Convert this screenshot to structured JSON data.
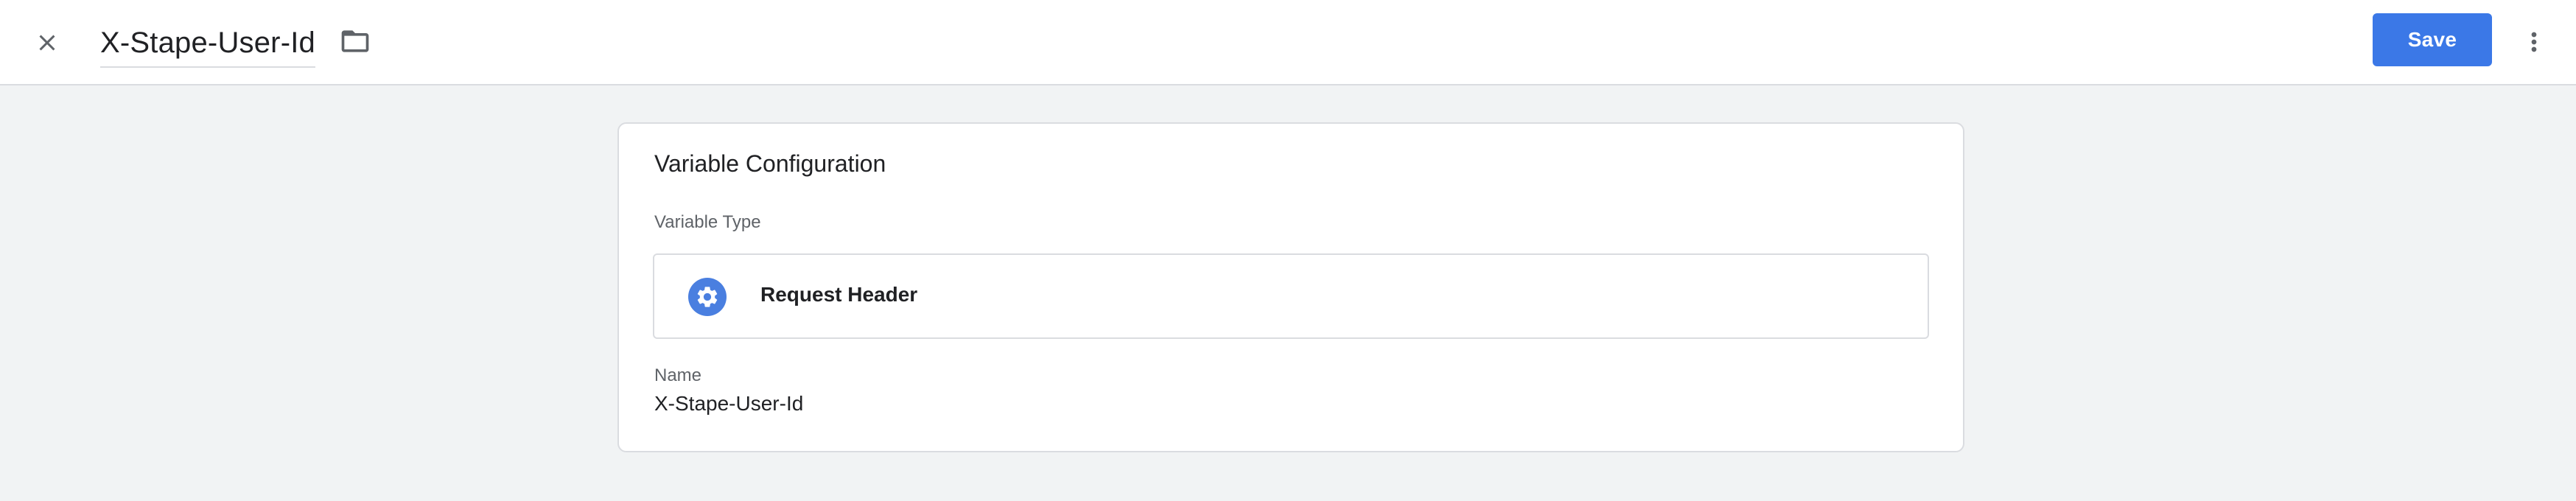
{
  "header": {
    "title": "X-Stape-User-Id",
    "save_label": "Save",
    "icons": {
      "close": "close-icon",
      "folder": "folder-icon",
      "more": "more-vert-icon"
    }
  },
  "card": {
    "title": "Variable Configuration",
    "variable_type_label": "Variable Type",
    "variable_type": {
      "name": "Request Header",
      "icon": "gear-icon",
      "icon_color": "#4a7fe0"
    },
    "name_label": "Name",
    "name_value": "X-Stape-User-Id"
  },
  "colors": {
    "accent": "#3b78e7",
    "background": "#f1f3f4"
  }
}
